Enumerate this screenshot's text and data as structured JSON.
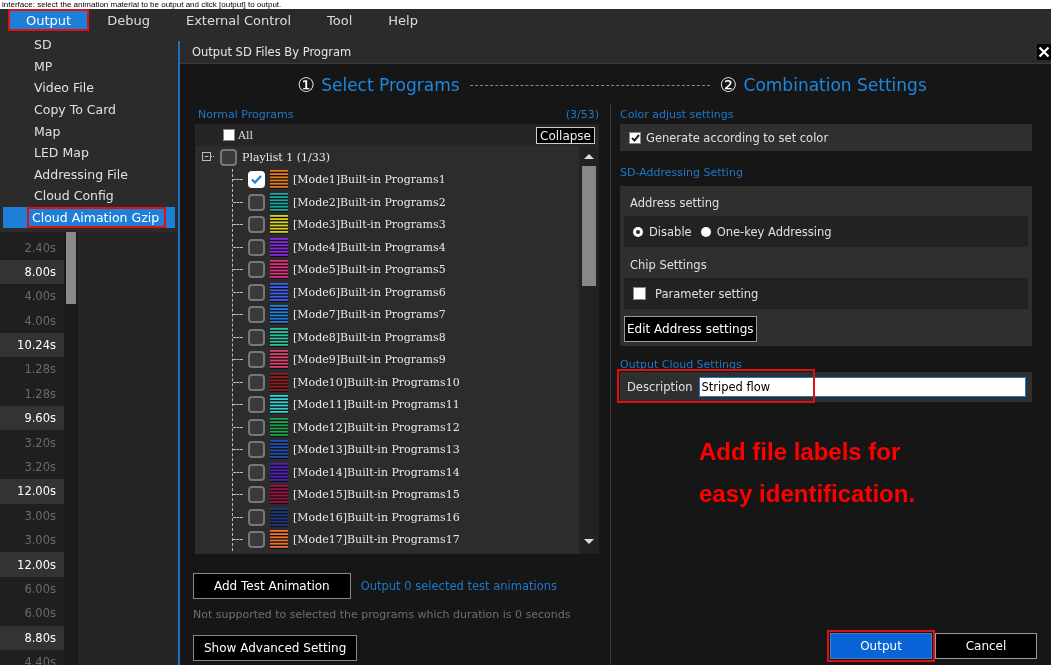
{
  "caption_fragment": "interface: select the animation material to be output and click [output] to output.",
  "menubar": [
    {
      "label": "Output",
      "selected": true,
      "marked": true
    },
    {
      "label": "Debug",
      "selected": false,
      "marked": false
    },
    {
      "label": "External Control",
      "selected": false,
      "marked": false
    },
    {
      "label": "Tool",
      "selected": false,
      "marked": false
    },
    {
      "label": "Help",
      "selected": false,
      "marked": false
    }
  ],
  "dropdown": [
    {
      "label": "SD",
      "selected": false,
      "marked": false
    },
    {
      "label": "MP",
      "selected": false,
      "marked": false
    },
    {
      "label": "Video File",
      "selected": false,
      "marked": false
    },
    {
      "label": "Copy To Card",
      "selected": false,
      "marked": false
    },
    {
      "label": "Map",
      "selected": false,
      "marked": false
    },
    {
      "label": "LED Map",
      "selected": false,
      "marked": false
    },
    {
      "label": "Addressing File",
      "selected": false,
      "marked": false
    },
    {
      "label": "Cloud Config",
      "selected": false,
      "marked": false
    },
    {
      "label": "Cloud Aimation Gzip",
      "selected": true,
      "marked": true
    }
  ],
  "durations": [
    {
      "text": "2.40s",
      "highlighted": false
    },
    {
      "text": "8.00s",
      "highlighted": true
    },
    {
      "text": "4.00s",
      "highlighted": false
    },
    {
      "text": "4.00s",
      "highlighted": false
    },
    {
      "text": "10.24s",
      "highlighted": true
    },
    {
      "text": "1.28s",
      "highlighted": false
    },
    {
      "text": "1.28s",
      "highlighted": false
    },
    {
      "text": "9.60s",
      "highlighted": true
    },
    {
      "text": "3.20s",
      "highlighted": false
    },
    {
      "text": "3.20s",
      "highlighted": false
    },
    {
      "text": "12.00s",
      "highlighted": true
    },
    {
      "text": "3.00s",
      "highlighted": false
    },
    {
      "text": "3.00s",
      "highlighted": false
    },
    {
      "text": "12.00s",
      "highlighted": true
    },
    {
      "text": "6.00s",
      "highlighted": false
    },
    {
      "text": "6.00s",
      "highlighted": false
    },
    {
      "text": "8.80s",
      "highlighted": true
    },
    {
      "text": "4.40s",
      "highlighted": false
    }
  ],
  "dialog": {
    "title": "Output SD Files By Program",
    "steps": [
      {
        "number": "①",
        "label": "Select Programs"
      },
      {
        "number": "②",
        "label": "Combination Settings"
      }
    ],
    "programs": {
      "title": "Normal Programs",
      "count": "(3/53)",
      "all_label": "All",
      "all_checked": false,
      "collapse": "Collapse",
      "playlist": {
        "label": "Playlist 1 (1/33)",
        "checked": false,
        "expanded": true,
        "children": [
          {
            "label": "[Mode1]Built-in Programs1",
            "checked": true,
            "color": "#e2791a"
          },
          {
            "label": "[Mode2]Built-in Programs2",
            "checked": false,
            "color": "#1aa7a0"
          },
          {
            "label": "[Mode3]Built-in Programs3",
            "checked": false,
            "color": "#d8d020"
          },
          {
            "label": "[Mode4]Built-in Programs4",
            "checked": false,
            "color": "#8a2be2"
          },
          {
            "label": "[Mode5]Built-in Programs5",
            "checked": false,
            "color": "#e03080"
          },
          {
            "label": "[Mode6]Built-in Programs6",
            "checked": false,
            "color": "#4060f0"
          },
          {
            "label": "[Mode7]Built-in Programs7",
            "checked": false,
            "color": "#2080e0"
          },
          {
            "label": "[Mode8]Built-in Programs8",
            "checked": false,
            "color": "#30c0a0"
          },
          {
            "label": "[Mode9]Built-in Programs9",
            "checked": false,
            "color": "#e04070"
          },
          {
            "label": "[Mode10]Built-in Programs10",
            "checked": false,
            "color": "#902020"
          },
          {
            "label": "[Mode11]Built-in Programs11",
            "checked": false,
            "color": "#30d0d0"
          },
          {
            "label": "[Mode12]Built-in Programs12",
            "checked": false,
            "color": "#20a050"
          },
          {
            "label": "[Mode13]Built-in Programs13",
            "checked": false,
            "color": "#2050b0"
          },
          {
            "label": "[Mode14]Built-in Programs14",
            "checked": false,
            "color": "#5020c0"
          },
          {
            "label": "[Mode15]Built-in Programs15",
            "checked": false,
            "color": "#a01040"
          },
          {
            "label": "[Mode16]Built-in Programs16",
            "checked": false,
            "color": "#203880"
          },
          {
            "label": "[Mode17]Built-in Programs17",
            "checked": false,
            "color": "#f07030"
          }
        ]
      }
    },
    "add_test": "Add Test Animation",
    "test_status": "Output 0 selected test animations",
    "note": "Not supported to selected the programs which duration is 0 seconds",
    "advanced": "Show Advanced Setting"
  },
  "settings": {
    "color_section": "Color adjust settings",
    "generate": {
      "label": "Generate according to set color",
      "checked": true
    },
    "sd_section": "SD-Addressing Setting",
    "address_title": "Address setting",
    "address_options": [
      {
        "label": "Disable",
        "selected": true
      },
      {
        "label": "One-key Addressing",
        "selected": false
      }
    ],
    "chip_title": "Chip Settings",
    "parameter": {
      "label": "Parameter setting",
      "checked": false
    },
    "edit_button": "Edit Address settings",
    "cloud_section": "Output Cloud Settings",
    "description": {
      "label": "Description",
      "value": "Striped flow",
      "marked": true
    }
  },
  "annotation": "Add file labels for easy identification.",
  "buttons": [
    {
      "label": "Output",
      "kind": "primary",
      "marked": true
    },
    {
      "label": "Cancel",
      "kind": "secondary",
      "marked": false
    }
  ]
}
